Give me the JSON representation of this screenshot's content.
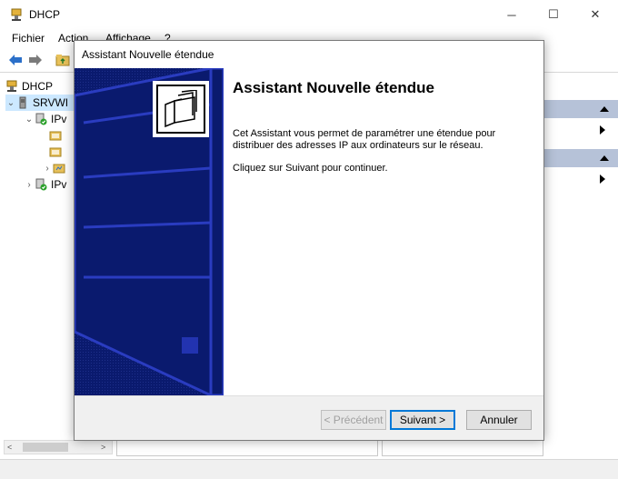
{
  "window": {
    "title": "DHCP",
    "controls": {
      "minimize": "─",
      "maximize": "☐",
      "close": "✕"
    }
  },
  "menu": {
    "items": [
      "Fichier",
      "Action",
      "Affichage",
      "?"
    ]
  },
  "tree": {
    "items": [
      {
        "label": "DHCP",
        "icon": "dhcp-icon"
      },
      {
        "label": "SRVWI",
        "icon": "server-icon"
      },
      {
        "label": "IPv",
        "icon": "ipv4-icon"
      },
      {
        "label": "",
        "icon": "folder-icon"
      },
      {
        "label": "",
        "icon": "folder-icon"
      },
      {
        "label": "",
        "icon": "folder-icon"
      },
      {
        "label": "IPv",
        "icon": "ipv6-icon"
      }
    ]
  },
  "dialog": {
    "title": "Assistant Nouvelle étendue",
    "heading": "Assistant Nouvelle étendue",
    "description": "Cet Assistant vous permet de paramétrer une étendue pour distribuer des adresses IP aux ordinateurs sur le réseau.",
    "instruction": "Cliquez sur Suivant pour continuer.",
    "buttons": {
      "previous": "< Précédent",
      "next": "Suivant >",
      "cancel": "Annuler"
    }
  },
  "colors": {
    "banner": "#0a1a6e",
    "accent": "#0078d7",
    "selection": "#cce8ff",
    "action_header": "#b6c2d8"
  }
}
